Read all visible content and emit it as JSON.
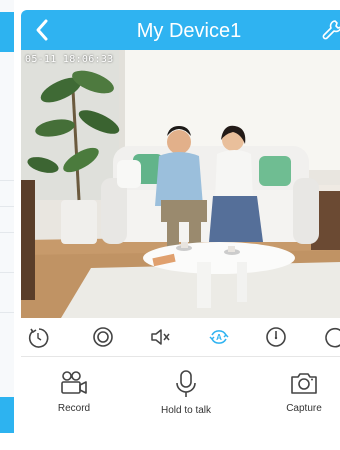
{
  "header": {
    "title": "My Device1"
  },
  "video": {
    "osd_timestamp": "05-11 18:06:33"
  },
  "controls": {
    "items": [
      "refresh-icon",
      "record-target-icon",
      "mute-icon",
      "auto-rotate-icon",
      "timer-icon",
      "more-icon"
    ],
    "active_color": "#2fb3f1"
  },
  "actions": {
    "record_label": "Record",
    "talk_label": "Hold to talk",
    "capture_label": "Capture"
  },
  "colors": {
    "accent": "#2fb3f1",
    "icon": "#444444"
  }
}
